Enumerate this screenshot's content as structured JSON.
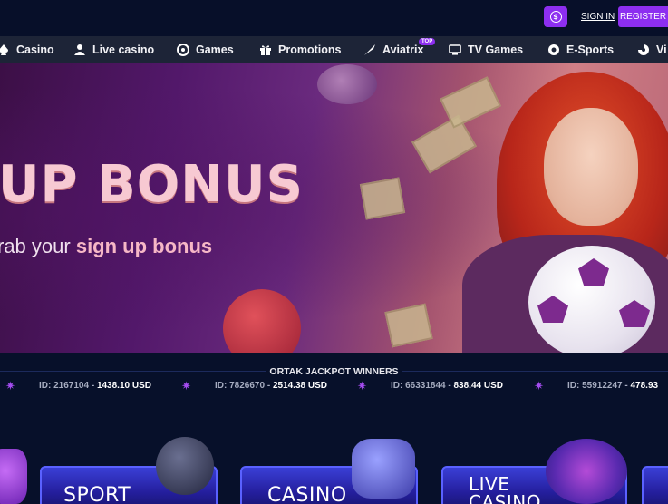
{
  "header": {
    "coin_symbol": "$",
    "signin_label": "SIGN IN",
    "register_label": "REGISTER"
  },
  "nav": {
    "items": [
      {
        "label": "Casino",
        "icon": "spade-icon"
      },
      {
        "label": "Live casino",
        "icon": "dealer-icon"
      },
      {
        "label": "Games",
        "icon": "gamepad-icon"
      },
      {
        "label": "Promotions",
        "icon": "gift-icon"
      },
      {
        "label": "Aviatrix",
        "icon": "plane-icon",
        "badge": "TOP"
      },
      {
        "label": "TV Games",
        "icon": "tv-icon"
      },
      {
        "label": "E-Sports",
        "icon": "esports-icon"
      },
      {
        "label": "Vi",
        "icon": "virtual-icon"
      }
    ]
  },
  "hero": {
    "title": "UP BONUS",
    "subtitle_pre": "rab your ",
    "subtitle_highlight": "sign up bonus"
  },
  "jackpot": {
    "title": "ORTAK JACKPOT WINNERS",
    "entries": [
      {
        "id": "ID: 2167104 - ",
        "amount": "1438.10 USD"
      },
      {
        "id": "ID: 7826670 - ",
        "amount": "2514.38 USD"
      },
      {
        "id": "ID: 66331844 - ",
        "amount": "838.44 USD"
      },
      {
        "id": "ID: 55912247 - ",
        "amount": "478.93"
      }
    ]
  },
  "categories": [
    {
      "label": "SPORT"
    },
    {
      "label": "CASINO"
    },
    {
      "label": "LIVE CASINO"
    }
  ],
  "colors": {
    "accent": "#8d2ef0",
    "background": "#07102a",
    "nav_bg": "#1d2437"
  }
}
